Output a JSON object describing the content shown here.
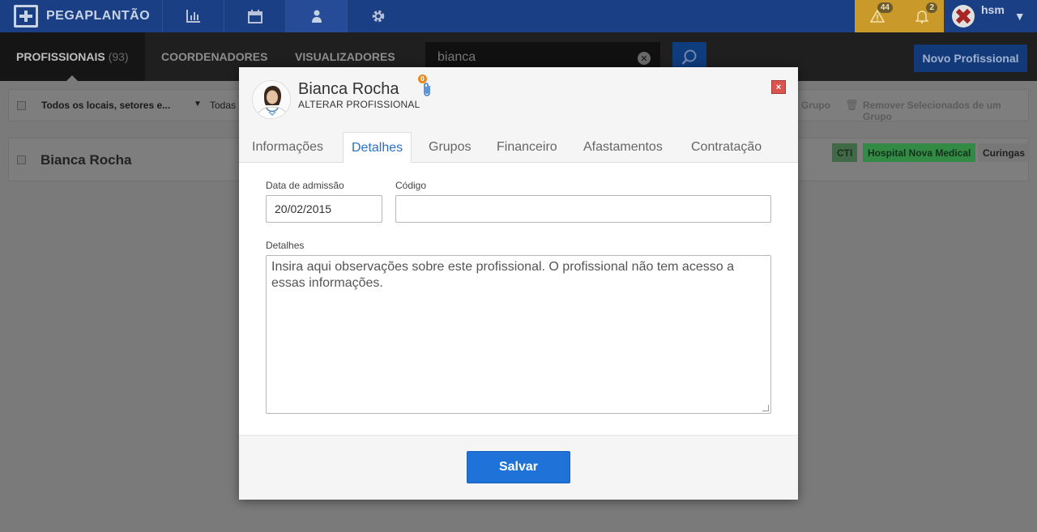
{
  "app": {
    "logo_text": "PEGAPLANTÃO",
    "nav_icons": [
      "bar-chart-icon",
      "calendar-icon",
      "user-icon",
      "gear-icon"
    ],
    "active_nav": "user-icon"
  },
  "alerts": {
    "warnings_count": "44",
    "notifications_count": "2"
  },
  "user": {
    "name": "hsm"
  },
  "subnav": {
    "tabs": [
      {
        "label": "PROFISSIONAIS",
        "count": "(93)"
      },
      {
        "label": "COORDENADORES"
      },
      {
        "label": "VISUALIZADORES"
      }
    ],
    "active_tab": "PROFISSIONAIS"
  },
  "search": {
    "value": "bianca"
  },
  "toolbar": {
    "new_label": "Novo Profissional"
  },
  "filters": {
    "locations": "Todos os locais, setores e...",
    "todas": "Todas",
    "group_action": "Grupo",
    "remove_action": "Remover Selecionados de um Grupo"
  },
  "list": {
    "rows": [
      {
        "name": "Bianca Rocha",
        "tags": [
          "CTI",
          "Hospital Nova Medical",
          "Curingas"
        ]
      }
    ]
  },
  "modal": {
    "title": "Bianca Rocha",
    "subtitle": "ALTERAR PROFISSIONAL",
    "attachment_count": "0",
    "close_label": "×",
    "tabs": [
      "Informações",
      "Detalhes",
      "Grupos",
      "Financeiro",
      "Afastamentos",
      "Contratação"
    ],
    "active_tab": "Detalhes",
    "fields": {
      "admission_label": "Data de admissão",
      "admission_value": "20/02/2015",
      "code_label": "Código",
      "code_value": "",
      "details_label": "Detalhes",
      "details_placeholder": "Insira aqui observações sobre este profissional. O profissional não tem acesso a essas informações."
    },
    "save_label": "Salvar"
  },
  "colors": {
    "topbar": "#1b3f85",
    "alerts": "#c99a2a",
    "primary_button": "#1f73d8",
    "active_tab_text": "#2a6fcb",
    "close_button": "#d9534f"
  }
}
